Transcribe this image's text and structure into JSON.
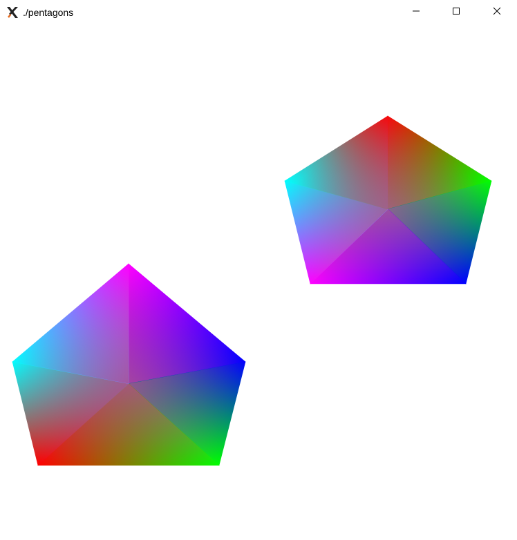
{
  "window": {
    "title": "./pentagons",
    "app_icon": "x-server-icon",
    "controls": {
      "minimize_icon": "minimize-icon",
      "maximize_icon": "maximize-icon",
      "close_icon": "close-icon"
    }
  },
  "canvas": {
    "background": "#ffffff",
    "shapes": [
      {
        "name": "pentagon-upper-right",
        "vertex_colors": [
          "#ff0000",
          "#00ff00",
          "#0000ff",
          "#ff00ff",
          "#00ffff"
        ],
        "center_color": "#a06090"
      },
      {
        "name": "pentagon-lower-left",
        "vertex_colors": [
          "#ff00ff",
          "#0000ff",
          "#00ff00",
          "#ff0000",
          "#00ffff"
        ],
        "center_color": "#aa5090"
      }
    ]
  }
}
